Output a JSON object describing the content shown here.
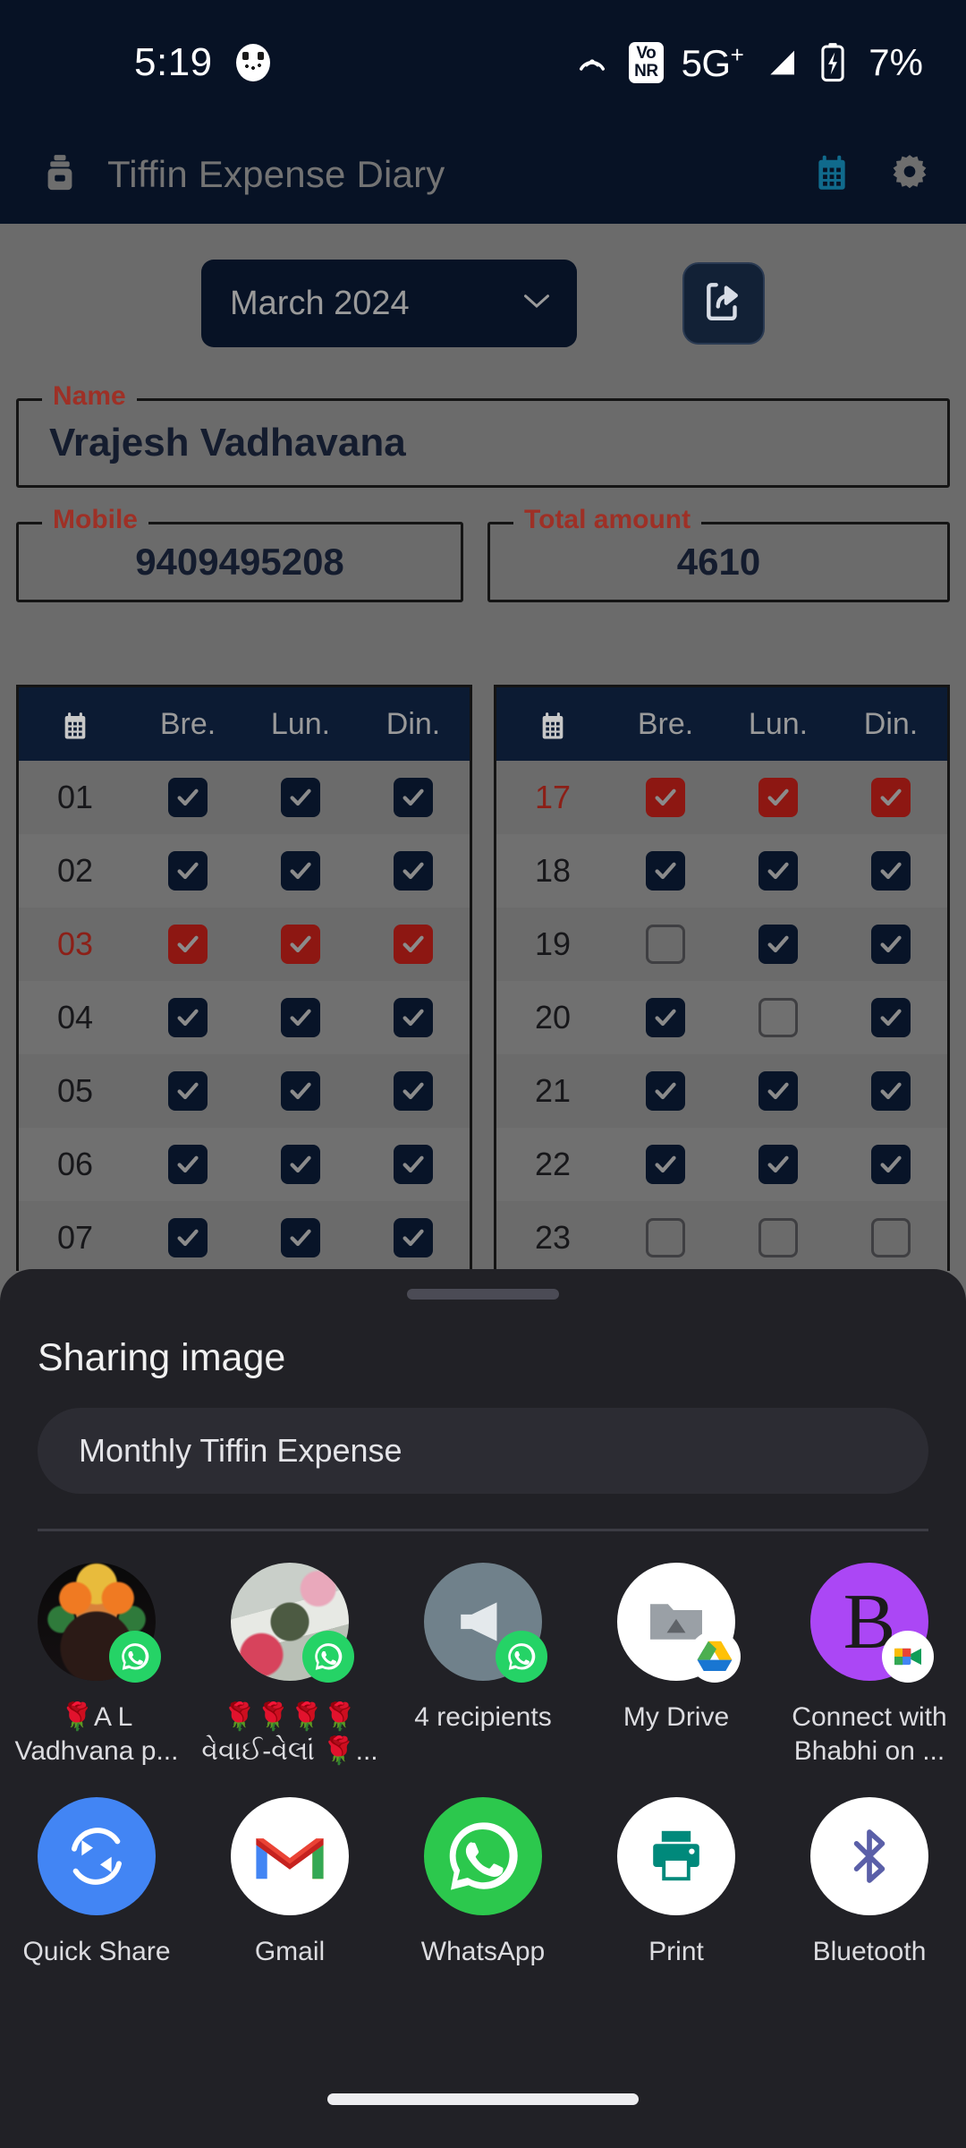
{
  "status_bar": {
    "time": "5:19",
    "app_dot_icon": "app-notification-icon",
    "hotspot_icon": "hotspot-icon",
    "vonr_line1": "Vo",
    "vonr_line2": "NR",
    "network": "5G",
    "network_sup": "+",
    "signal_icon": "signal-bars-icon",
    "battery_icon": "battery-charging-icon",
    "battery_percent": "7%"
  },
  "app_bar": {
    "app_icon": "lunchbox-icon",
    "title": "Tiffin Expense Diary",
    "calendar_icon": "calendar-icon",
    "settings_icon": "gear-icon",
    "calendar_color": "#106a8c",
    "settings_color": "#6e6e6e"
  },
  "toolbar": {
    "month_value": "March 2024",
    "month_chevron_icon": "chevron-down-icon",
    "share_icon": "share-export-icon"
  },
  "form": {
    "name_label": "Name",
    "name_value": "Vrajesh Vadhavana",
    "mobile_label": "Mobile",
    "mobile_value": "9409495208",
    "total_label": "Total amount",
    "total_value": "4610",
    "label_color": "#9e3026"
  },
  "table": {
    "day_header_icon": "calendar-icon",
    "columns": [
      "Bre.",
      "Lun.",
      "Din."
    ],
    "left_rows": [
      {
        "day": "01",
        "holiday": false,
        "checks": [
          "on",
          "on",
          "on"
        ]
      },
      {
        "day": "02",
        "holiday": false,
        "checks": [
          "on",
          "on",
          "on"
        ]
      },
      {
        "day": "03",
        "holiday": true,
        "checks": [
          "red",
          "red",
          "red"
        ]
      },
      {
        "day": "04",
        "holiday": false,
        "checks": [
          "on",
          "on",
          "on"
        ]
      },
      {
        "day": "05",
        "holiday": false,
        "checks": [
          "on",
          "on",
          "on"
        ]
      },
      {
        "day": "06",
        "holiday": false,
        "checks": [
          "on",
          "on",
          "on"
        ]
      },
      {
        "day": "07",
        "holiday": false,
        "checks": [
          "on",
          "on",
          "on"
        ]
      }
    ],
    "right_rows": [
      {
        "day": "17",
        "holiday": true,
        "checks": [
          "red",
          "red",
          "red"
        ]
      },
      {
        "day": "18",
        "holiday": false,
        "checks": [
          "on",
          "on",
          "on"
        ]
      },
      {
        "day": "19",
        "holiday": false,
        "checks": [
          "off",
          "on",
          "on"
        ]
      },
      {
        "day": "20",
        "holiday": false,
        "checks": [
          "on",
          "off",
          "on"
        ]
      },
      {
        "day": "21",
        "holiday": false,
        "checks": [
          "on",
          "on",
          "on"
        ]
      },
      {
        "day": "22",
        "holiday": false,
        "checks": [
          "on",
          "on",
          "on"
        ]
      },
      {
        "day": "23",
        "holiday": false,
        "checks": [
          "off",
          "off",
          "off"
        ]
      }
    ]
  },
  "share_sheet": {
    "handle_icon": "drag-handle",
    "title": "Sharing image",
    "subject_value": "Monthly Tiffin Expense",
    "contacts": [
      {
        "label": "🌹A L Vadhvana p...",
        "avatar": "krishna-photo",
        "badge": "whatsapp-icon"
      },
      {
        "label": "🌹🌹🌹🌹 વેવાઈ-વેલાં 🌹...",
        "avatar": "temple-photo",
        "badge": "whatsapp-icon"
      },
      {
        "label": "4 recipients",
        "avatar": "broadcast-icon",
        "badge": "whatsapp-icon"
      },
      {
        "label": "My Drive",
        "avatar": "drive-folder-icon",
        "badge": "google-drive-icon"
      },
      {
        "label": "Connect with Bhabhi on ...",
        "avatar": "meet-avatar-b",
        "badge": "google-meet-icon"
      }
    ],
    "apps": [
      {
        "label": "Quick Share",
        "icon": "quick-share-icon"
      },
      {
        "label": "Gmail",
        "icon": "gmail-icon"
      },
      {
        "label": "WhatsApp",
        "icon": "whatsapp-icon"
      },
      {
        "label": "Print",
        "icon": "printer-icon"
      },
      {
        "label": "Bluetooth",
        "icon": "bluetooth-icon"
      }
    ]
  },
  "nav_bar": {
    "gesture_pill": "home-gesture-pill"
  },
  "colors": {
    "app_bar_bg": "#071225",
    "scrim": "#6b6b6b",
    "sheet_bg": "#212126",
    "accent_red": "#8d1712",
    "check_navy": "#081428",
    "teal": "#106a8c",
    "whatsapp_green": "#25D366"
  }
}
